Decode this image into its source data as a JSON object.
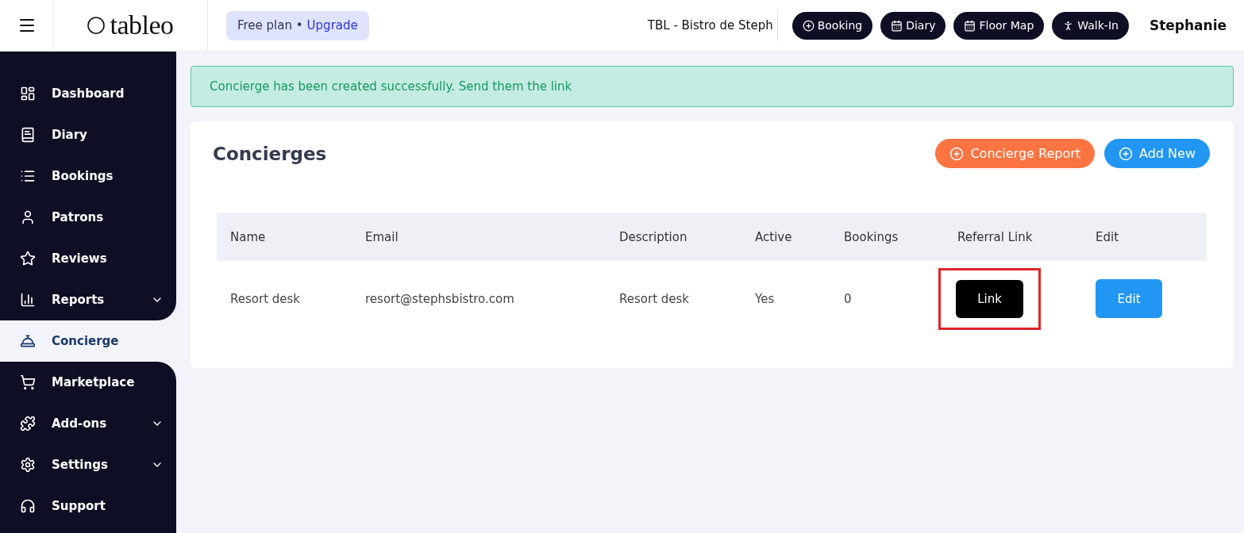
{
  "header": {
    "logo": "tableo",
    "plan": {
      "label": "Free plan •",
      "link": "Upgrade"
    },
    "venue": "TBL - Bistro de Steph",
    "actions": [
      {
        "label": "Booking"
      },
      {
        "label": "Diary"
      },
      {
        "label": "Floor Map"
      },
      {
        "label": "Walk-In"
      }
    ],
    "user": "Stephanie"
  },
  "sidebar": {
    "items": [
      {
        "label": "Dashboard",
        "selected": false
      },
      {
        "label": "Diary",
        "selected": false
      },
      {
        "label": "Bookings",
        "selected": false
      },
      {
        "label": "Patrons",
        "selected": false
      },
      {
        "label": "Reviews",
        "selected": false
      },
      {
        "label": "Reports",
        "selected": false,
        "expandable": true
      },
      {
        "label": "Concierge",
        "selected": true
      },
      {
        "label": "Marketplace",
        "selected": false
      },
      {
        "label": "Add-ons",
        "selected": false,
        "expandable": true
      },
      {
        "label": "Settings",
        "selected": false,
        "expandable": true
      },
      {
        "label": "Support",
        "selected": false
      }
    ]
  },
  "alert": "Concierge has been created successfully. Send them the link",
  "panel": {
    "title": "Concierges",
    "buttons": [
      {
        "label": "Concierge Report",
        "kind": "report"
      },
      {
        "label": "Add New",
        "kind": "add"
      }
    ],
    "table": {
      "columns": [
        "Name",
        "Email",
        "Description",
        "Active",
        "Bookings",
        "Referral Link",
        "Edit"
      ],
      "rows": [
        {
          "name": "Resort desk",
          "email": "resort@stephsbistro.com",
          "description": "Resort desk",
          "active": "Yes",
          "bookings": "0",
          "link": "Link",
          "link_highlighted": true,
          "edit": "Edit"
        }
      ]
    }
  }
}
